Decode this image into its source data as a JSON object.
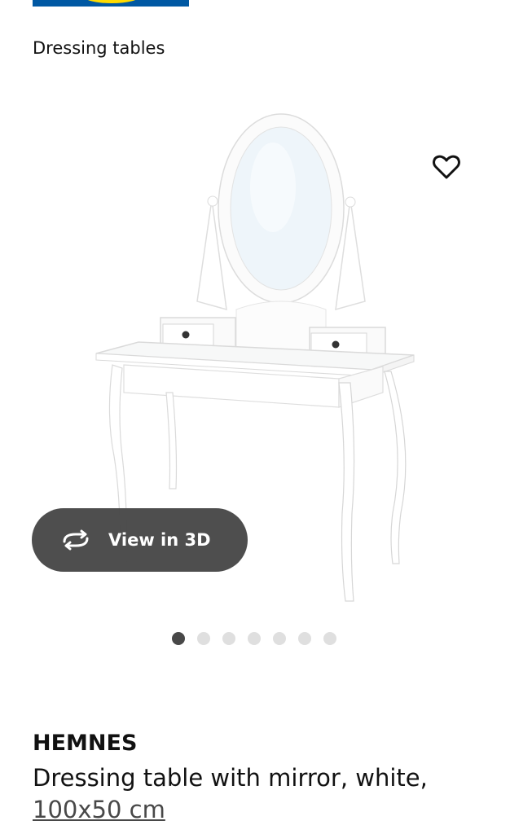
{
  "breadcrumb": "Dressing tables",
  "product": {
    "name": "HEMNES",
    "description": "Dressing table with mirror, white,",
    "size": "100x50 cm"
  },
  "view3d_label": "View in 3D",
  "icons": {
    "favorite": "heart-outline-icon",
    "view3d": "rotate-3d-icon"
  },
  "carousel": {
    "count": 7,
    "active_index": 0
  },
  "colors": {
    "logo_blue": "#0058a3",
    "logo_yellow": "#ffdb00",
    "button_dark": "#484848"
  }
}
